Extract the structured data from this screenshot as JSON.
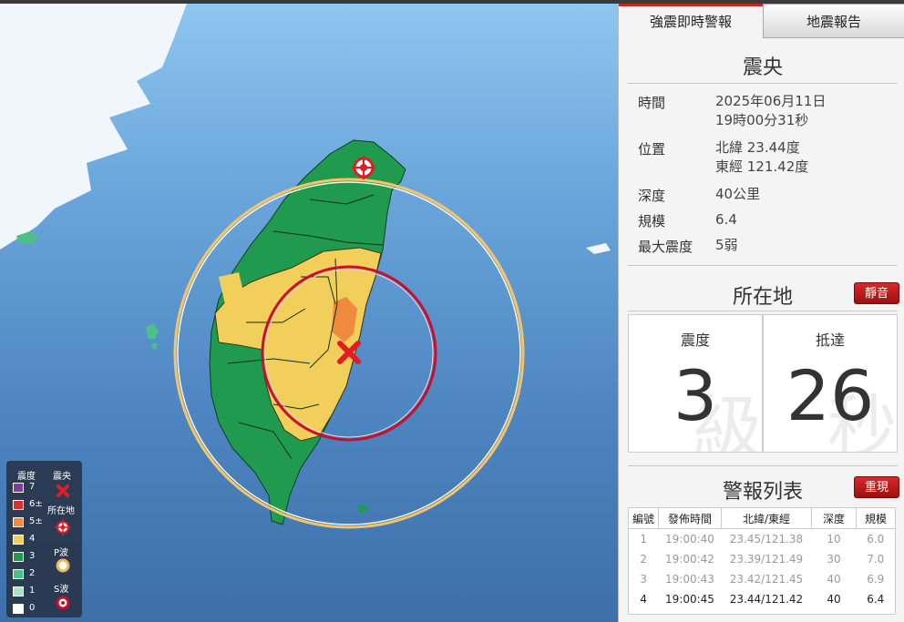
{
  "tabs": {
    "active": "強震即時警報",
    "inactive": "地震報告"
  },
  "epicenter": {
    "title": "震央",
    "time_label": "時間",
    "time_date": "2025年06月11日",
    "time_clock": "19時00分31秒",
    "location_label": "位置",
    "lat": "北緯 23.44度",
    "lon": "東經 121.42度",
    "depth_label": "深度",
    "depth": "40公里",
    "magnitude_label": "規模",
    "magnitude": "6.4",
    "max_intensity_label": "最大震度",
    "max_intensity": "5弱"
  },
  "local": {
    "title": "所在地",
    "mute_label": "靜音",
    "intensity_label": "震度",
    "intensity": "3",
    "intensity_unit": "級",
    "arrival_label": "抵達",
    "arrival": "26",
    "arrival_unit": "秒"
  },
  "alerts": {
    "title": "警報列表",
    "replay_label": "重現",
    "columns": [
      "編號",
      "發佈時間",
      "北緯/東經",
      "深度",
      "規模"
    ],
    "rows": [
      [
        "1",
        "19:00:40",
        "23.45/121.38",
        "10",
        "6.0"
      ],
      [
        "2",
        "19:00:42",
        "23.39/121.49",
        "30",
        "7.0"
      ],
      [
        "3",
        "19:00:43",
        "23.42/121.45",
        "40",
        "6.9"
      ],
      [
        "4",
        "19:00:45",
        "23.44/121.42",
        "40",
        "6.4"
      ]
    ]
  },
  "legend": {
    "intensity_title": "震度",
    "levels": [
      {
        "label": "7",
        "color": "#7b3fa0"
      },
      {
        "label": "6±",
        "color": "#d9302c"
      },
      {
        "label": "5±",
        "color": "#f08a3c"
      },
      {
        "label": "4",
        "color": "#f2cf5a"
      },
      {
        "label": "3",
        "color": "#1f9a4e"
      },
      {
        "label": "2",
        "color": "#4fbf88"
      },
      {
        "label": "1",
        "color": "#a9e2c5"
      },
      {
        "label": "0",
        "color": "#ffffff"
      }
    ],
    "epicenter_label": "震央",
    "location_label": "所在地",
    "p_wave_label": "P波",
    "s_wave_label": "S波"
  }
}
